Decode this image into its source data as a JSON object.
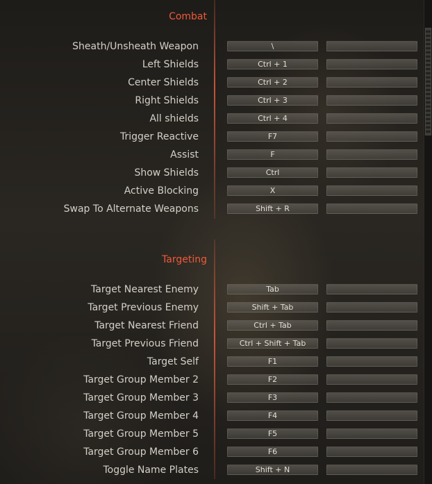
{
  "sections": [
    {
      "title": "Combat",
      "rows": [
        {
          "label": "Sheath/Unsheath Weapon",
          "primary": "\\",
          "secondary": ""
        },
        {
          "label": "Left Shields",
          "primary": "Ctrl + 1",
          "secondary": ""
        },
        {
          "label": "Center Shields",
          "primary": "Ctrl + 2",
          "secondary": ""
        },
        {
          "label": "Right Shields",
          "primary": "Ctrl + 3",
          "secondary": ""
        },
        {
          "label": "All shields",
          "primary": "Ctrl + 4",
          "secondary": ""
        },
        {
          "label": "Trigger Reactive",
          "primary": "F7",
          "secondary": ""
        },
        {
          "label": "Assist",
          "primary": "F",
          "secondary": ""
        },
        {
          "label": "Show Shields",
          "primary": "Ctrl",
          "secondary": ""
        },
        {
          "label": "Active Blocking",
          "primary": "X",
          "secondary": ""
        },
        {
          "label": "Swap To Alternate Weapons",
          "primary": "Shift + R",
          "secondary": ""
        }
      ]
    },
    {
      "title": "Targeting",
      "rows": [
        {
          "label": "Target Nearest Enemy",
          "primary": "Tab",
          "secondary": ""
        },
        {
          "label": "Target Previous Enemy",
          "primary": "Shift + Tab",
          "secondary": ""
        },
        {
          "label": "Target Nearest Friend",
          "primary": "Ctrl + Tab",
          "secondary": ""
        },
        {
          "label": "Target Previous Friend",
          "primary": "Ctrl + Shift + Tab",
          "secondary": ""
        },
        {
          "label": "Target Self",
          "primary": "F1",
          "secondary": ""
        },
        {
          "label": "Target Group Member 2",
          "primary": "F2",
          "secondary": ""
        },
        {
          "label": "Target Group Member 3",
          "primary": "F3",
          "secondary": ""
        },
        {
          "label": "Target Group Member 4",
          "primary": "F4",
          "secondary": ""
        },
        {
          "label": "Target Group Member 5",
          "primary": "F5",
          "secondary": ""
        },
        {
          "label": "Target Group Member 6",
          "primary": "F6",
          "secondary": ""
        },
        {
          "label": "Toggle Name Plates",
          "primary": "Shift + N",
          "secondary": ""
        }
      ]
    }
  ]
}
